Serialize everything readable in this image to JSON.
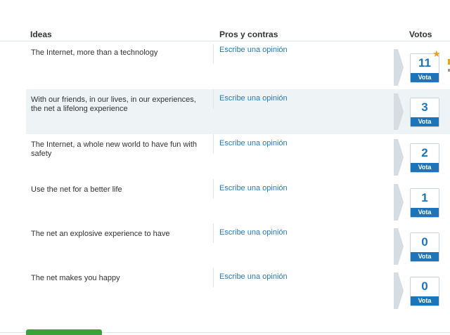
{
  "header": {
    "ideas": "Ideas",
    "pros": "Pros y contras",
    "votes": "Votos"
  },
  "rows": [
    {
      "idea": "The Internet, more than a technology",
      "opinion": "Escribe una opinión",
      "votes": "11",
      "vote_label": "Vota"
    },
    {
      "idea": "With our friends, in our lives, in our experiences, the net a lifelong experience",
      "opinion": "Escribe una opinión",
      "votes": "3",
      "vote_label": "Vota"
    },
    {
      "idea": "The Internet, a whole new world to have fun with safety",
      "opinion": "Escribe una opinión",
      "votes": "2",
      "vote_label": "Vota"
    },
    {
      "idea": "Use the net for a better life",
      "opinion": "Escribe una opinión",
      "votes": "1",
      "vote_label": "Vota"
    },
    {
      "idea": "The net an explosive experience to have",
      "opinion": "Escribe una opinión",
      "votes": "0",
      "vote_label": "Vota"
    },
    {
      "idea": "The net makes you happy",
      "opinion": "Escribe una opinión",
      "votes": "0",
      "vote_label": "Vota"
    }
  ],
  "icons": {
    "top_idea": "star-icon"
  },
  "colors": {
    "accent": "#1d74b8",
    "link": "#2a7ab8",
    "alt_row": "#eef3f6",
    "star": "#f39c12",
    "button": "#3aa23a"
  }
}
